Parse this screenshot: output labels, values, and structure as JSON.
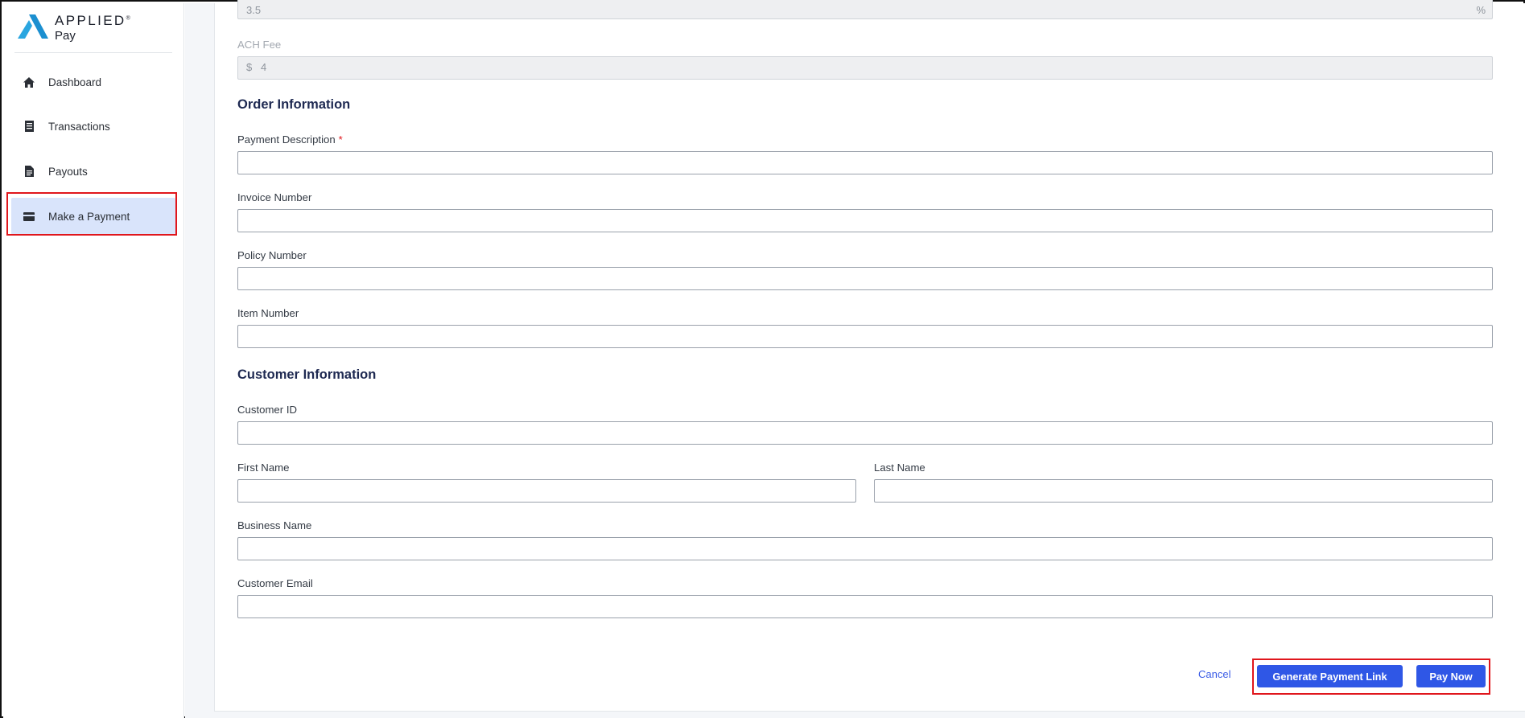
{
  "brand": {
    "name": "APPLIED",
    "trademark": "®",
    "product": "Pay"
  },
  "sidebar": {
    "items": [
      {
        "label": "Dashboard",
        "icon": "home-icon"
      },
      {
        "label": "Transactions",
        "icon": "ledger-icon"
      },
      {
        "label": "Payouts",
        "icon": "document-icon"
      },
      {
        "label": "Make a Payment",
        "icon": "credit-card-icon",
        "active": true
      }
    ]
  },
  "fees": {
    "card_fee_value": "3.5",
    "card_fee_suffix": "%",
    "ach_fee_label": "ACH Fee",
    "ach_fee_prefix": "$",
    "ach_fee_value": "4"
  },
  "order_info": {
    "title": "Order Information",
    "payment_description_label": "Payment Description",
    "required_marker": "*",
    "invoice_number_label": "Invoice Number",
    "policy_number_label": "Policy Number",
    "item_number_label": "Item Number"
  },
  "customer_info": {
    "title": "Customer Information",
    "customer_id_label": "Customer ID",
    "first_name_label": "First Name",
    "last_name_label": "Last Name",
    "business_name_label": "Business Name",
    "customer_email_label": "Customer Email"
  },
  "actions": {
    "cancel_label": "Cancel",
    "generate_link_label": "Generate Payment Link",
    "pay_now_label": "Pay Now"
  },
  "colors": {
    "accent": "#2f57e6",
    "active_nav_bg": "#d9e4fb",
    "highlight": "#e0161c",
    "heading": "#1f2a52"
  }
}
